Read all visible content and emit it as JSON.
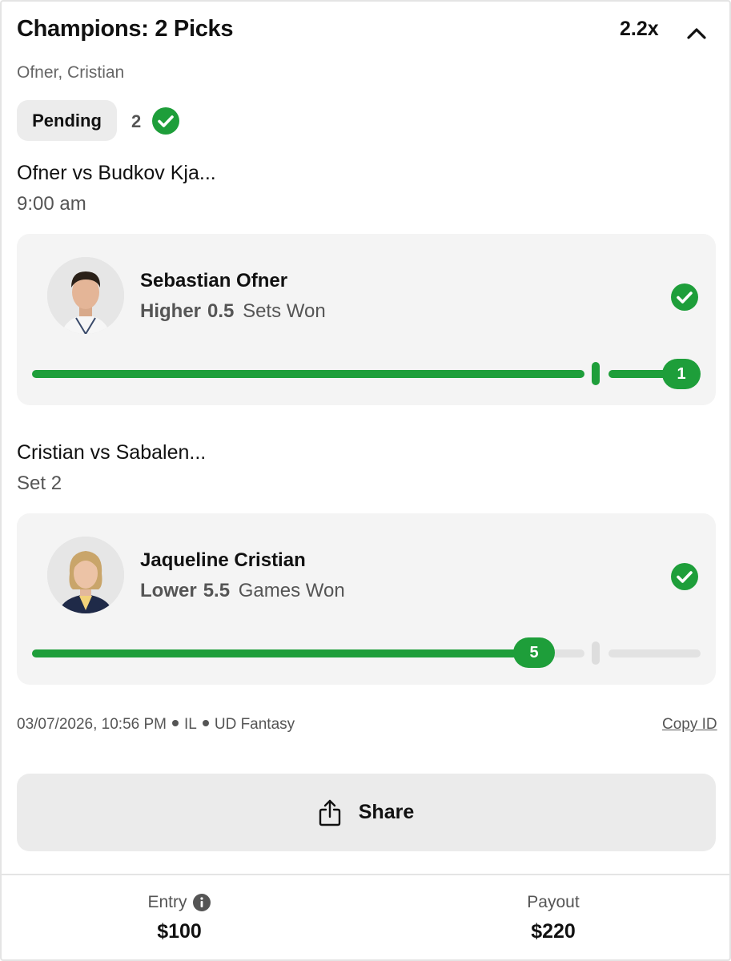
{
  "header": {
    "title": "Champions: 2 Picks",
    "multiplier": "2.2x"
  },
  "players_line": "Ofner, Cristian",
  "status": {
    "label": "Pending",
    "wins": "2"
  },
  "picks": [
    {
      "match_title": "Ofner vs Budkov Kja...",
      "match_sub": "9:00 am",
      "player": "Sebastian Ofner",
      "direction": "Higher",
      "line": "0.5",
      "stat": "Sets Won",
      "current": "1",
      "progress": 1.0
    },
    {
      "match_title": "Cristian vs Sabalen...",
      "match_sub": "Set 2",
      "player": "Jaqueline Cristian",
      "direction": "Lower",
      "line": "5.5",
      "stat": "Games Won",
      "current": "5",
      "progress": 0.909
    }
  ],
  "meta": {
    "datetime": "03/07/2026, 10:56 PM",
    "state": "IL",
    "product": "UD Fantasy",
    "copy_id": "Copy ID"
  },
  "share": {
    "label": "Share"
  },
  "footer": {
    "entry_label": "Entry",
    "entry_value": "$100",
    "payout_label": "Payout",
    "payout_value": "$220"
  },
  "colors": {
    "accent_green": "#1e9e3a",
    "card_bg": "#f4f4f4",
    "pill_bg": "#ececec"
  }
}
